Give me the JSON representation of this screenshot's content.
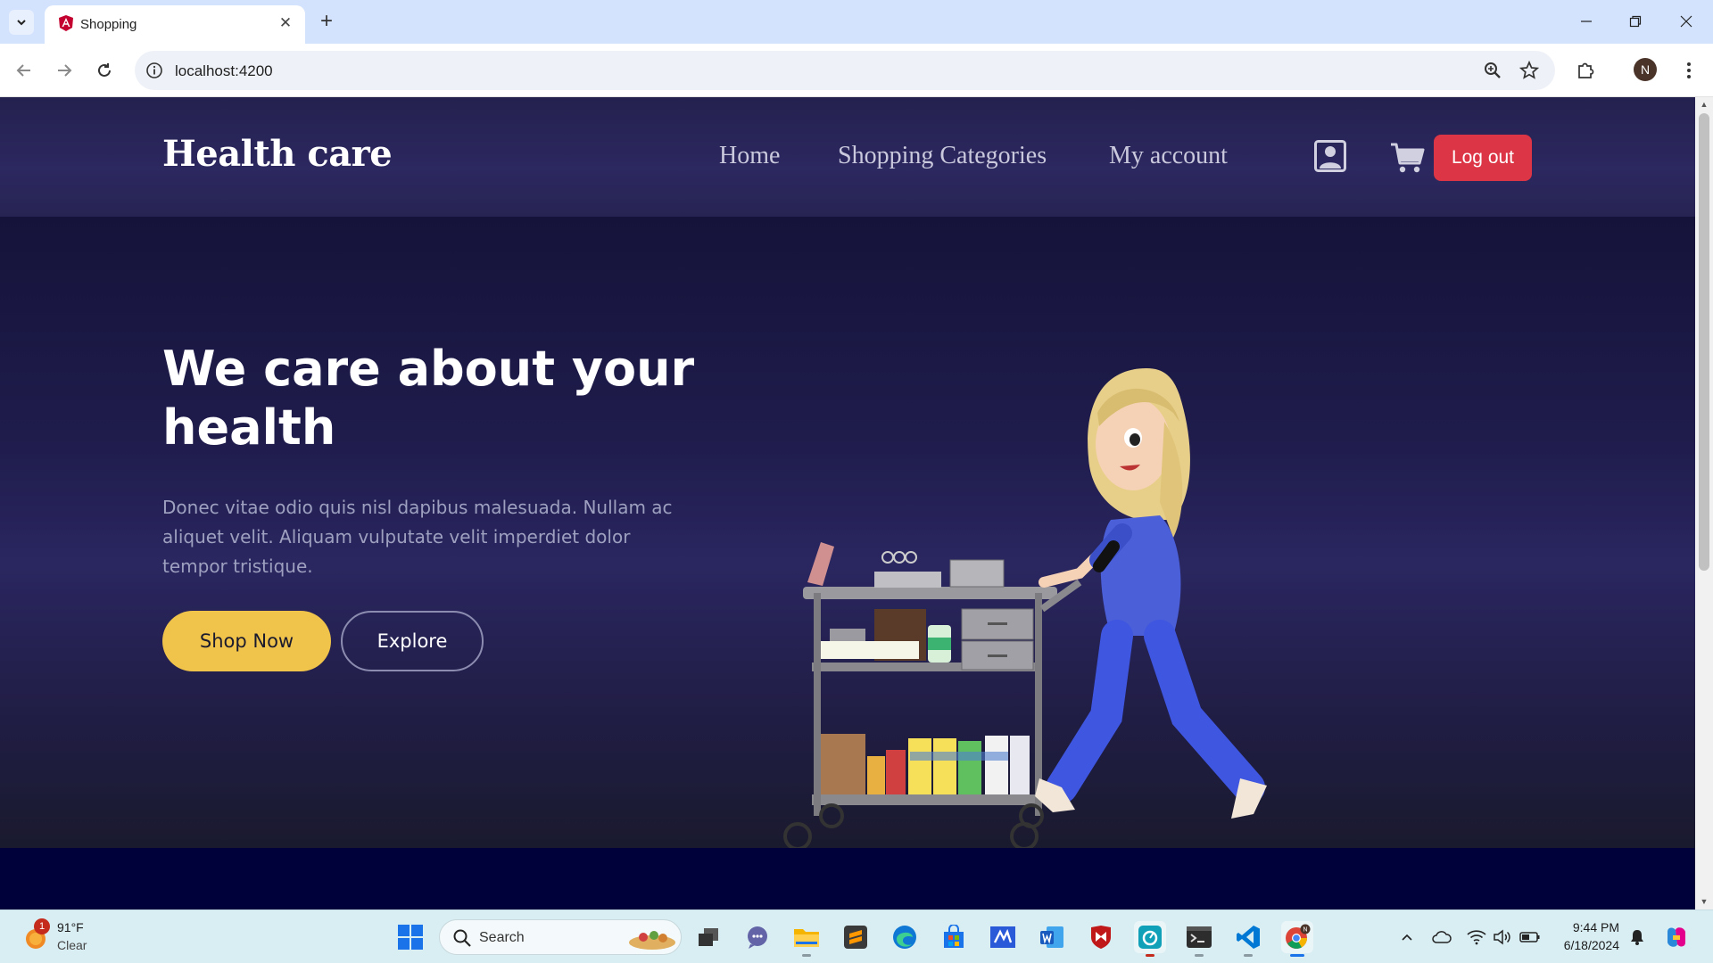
{
  "browser": {
    "tab_title": "Shopping",
    "url": "localhost:4200",
    "profile_initial": "N"
  },
  "site": {
    "brand": "Health care",
    "nav": [
      "Home",
      "Shopping Categories",
      "My account"
    ],
    "logout_label": "Log out",
    "hero": {
      "title": "We care about your health",
      "text": "Donec vitae odio quis nisl dapibus malesuada. Nullam ac aliquet velit. Aliquam vulputate velit imperdiet dolor tempor tristique.",
      "primary_button": "Shop Now",
      "secondary_button": "Explore"
    },
    "colors": {
      "header_bg": "#2a2660",
      "logout_bg": "#dc3545",
      "shop_button_bg": "#f0c34a",
      "bottom_band_bg": "#00003a"
    }
  },
  "taskbar": {
    "weather": {
      "badge": "1",
      "temp": "91°F",
      "condition": "Clear"
    },
    "search_label": "Search",
    "apps": [
      "task-view",
      "teams-chat",
      "file-explorer",
      "sublime-text",
      "edge",
      "microsoft-store",
      "visual-studio",
      "word",
      "mcafee",
      "snipping-tool",
      "terminal",
      "vscode",
      "chrome"
    ],
    "clock": {
      "time": "9:44 PM",
      "date": "6/18/2024"
    }
  }
}
